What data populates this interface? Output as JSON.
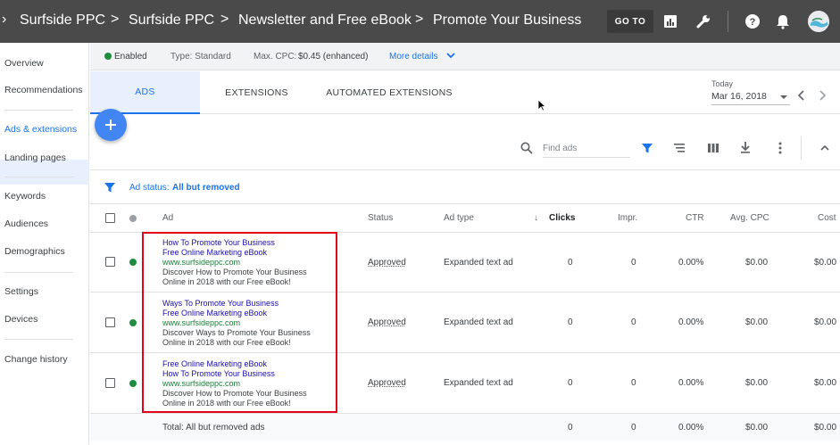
{
  "breadcrumb": {
    "items": [
      "Surfside PPC",
      "Surfside PPC",
      "Newsletter and Free eBook",
      "Promote Your Business"
    ],
    "separator": ">"
  },
  "topbar": {
    "goto_label": "GO TO"
  },
  "sidebar": {
    "items": [
      {
        "label": "Overview"
      },
      {
        "label": "Recommendations"
      },
      {
        "label": "Ads & extensions"
      },
      {
        "label": "Landing pages"
      },
      {
        "label": "Keywords"
      },
      {
        "label": "Audiences"
      },
      {
        "label": "Demographics"
      },
      {
        "label": "Settings"
      },
      {
        "label": "Devices"
      },
      {
        "label": "Change history"
      }
    ],
    "active_index": 2
  },
  "status": {
    "state": "Enabled",
    "type": "Type: Standard",
    "cpc_label": "Max. CPC:",
    "cpc_value": "$0.45 (enhanced)",
    "more": "More details"
  },
  "tabs": [
    "ADS",
    "EXTENSIONS",
    "AUTOMATED EXTENSIONS"
  ],
  "date": {
    "label": "Today",
    "value": "Mar 16, 2018"
  },
  "search": {
    "placeholder": "Find ads"
  },
  "filter": {
    "label": "Ad status:",
    "value": "All but removed"
  },
  "columns": [
    "Ad",
    "Status",
    "Ad type",
    "Clicks",
    "Impr.",
    "CTR",
    "Avg. CPC",
    "Cost"
  ],
  "rows": [
    {
      "headline1": "How To Promote Your Business",
      "headline2": "Free Online Marketing eBook",
      "url": "www.surfsideppc.com",
      "desc1": "Discover How to Promote Your Business",
      "desc2": "Online in 2018 with our Free eBook!",
      "status": "Approved",
      "ad_type": "Expanded text ad",
      "clicks": "0",
      "impr": "0",
      "ctr": "0.00%",
      "avg_cpc": "$0.00",
      "cost": "$0.00"
    },
    {
      "headline1": "Ways To Promote Your Business",
      "headline2": "Free Online Marketing eBook",
      "url": "www.surfsideppc.com",
      "desc1": "Discover Ways to Promote Your Business",
      "desc2": "Online in 2018 with our Free eBook!",
      "status": "Approved",
      "ad_type": "Expanded text ad",
      "clicks": "0",
      "impr": "0",
      "ctr": "0.00%",
      "avg_cpc": "$0.00",
      "cost": "$0.00"
    },
    {
      "headline1": "Free Online Marketing eBook",
      "headline2": "How To Promote Your Business",
      "url": "www.surfsideppc.com",
      "desc1": "Discover How to Promote Your Business",
      "desc2": "Online in 2018 with our Free eBook!",
      "status": "Approved",
      "ad_type": "Expanded text ad",
      "clicks": "0",
      "impr": "0",
      "ctr": "0.00%",
      "avg_cpc": "$0.00",
      "cost": "$0.00"
    }
  ],
  "total": {
    "label": "Total: All but removed ads",
    "clicks": "0",
    "impr": "0",
    "ctr": "0.00%",
    "avg_cpc": "$0.00",
    "cost": "$0.00"
  },
  "colors": {
    "accent": "#1a73e8",
    "enabled": "#1e8e3e",
    "highlight": "#e5001a",
    "topbar": "#4a4a4a"
  }
}
